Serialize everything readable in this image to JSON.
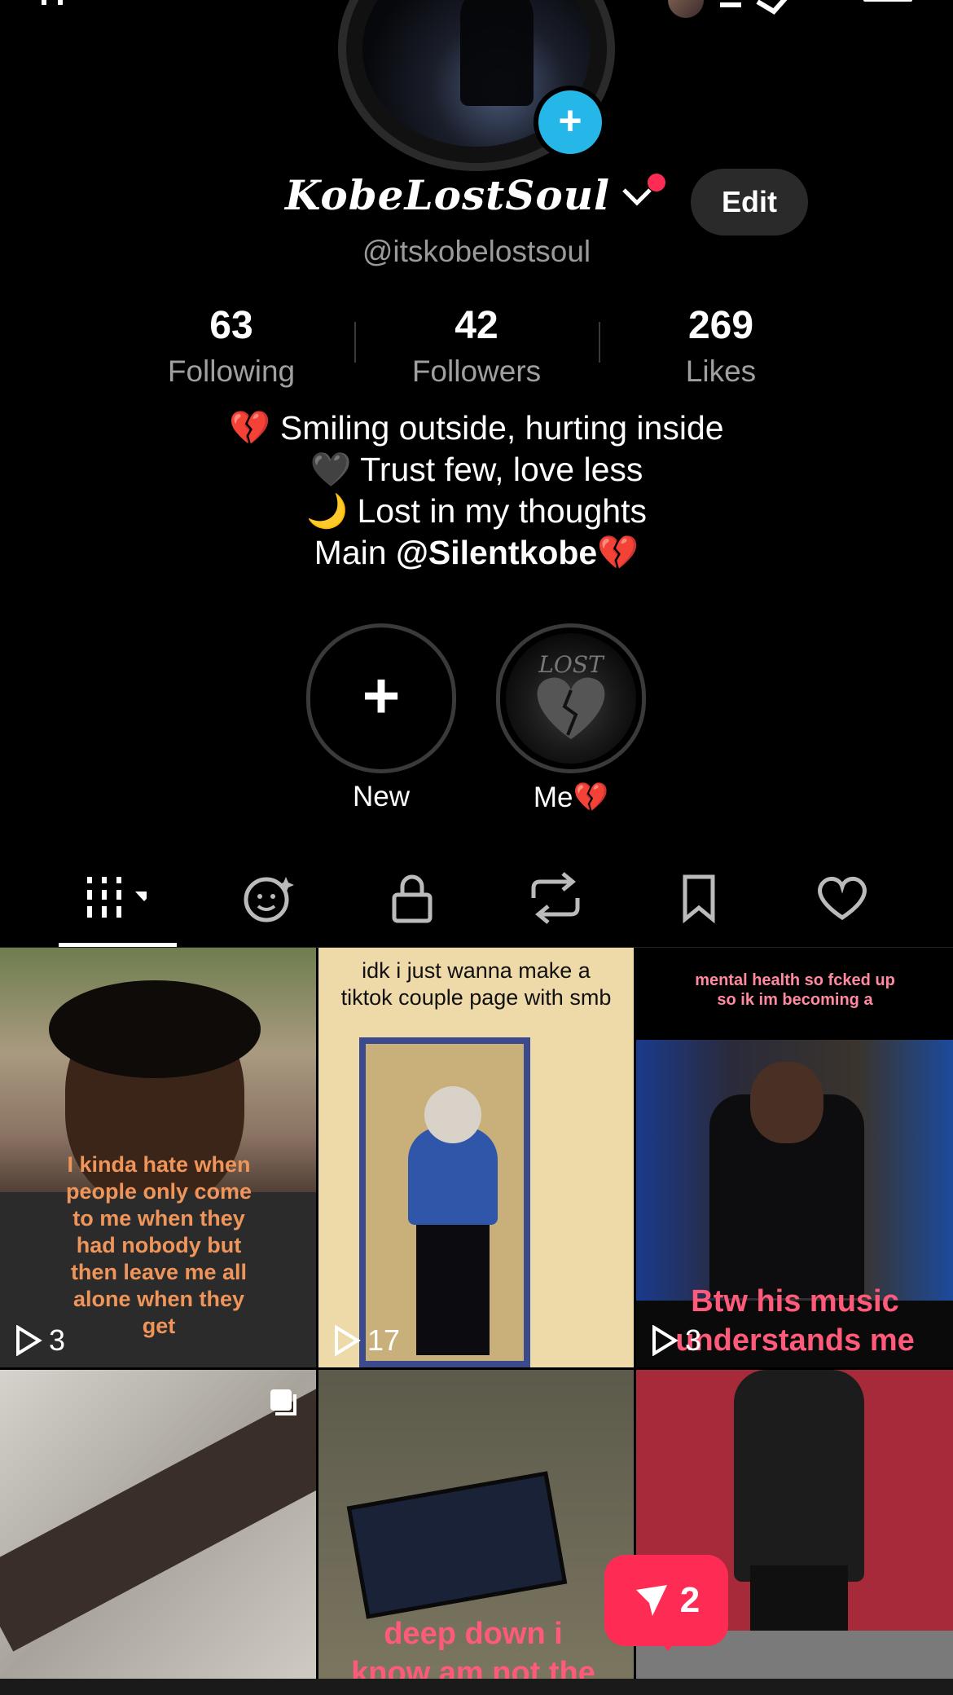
{
  "profile": {
    "display_name": "KobeLostSoul",
    "handle": "@itskobelostsoul",
    "edit_label": "Edit",
    "stats": [
      {
        "value": "63",
        "label": "Following"
      },
      {
        "value": "42",
        "label": "Followers"
      },
      {
        "value": "269",
        "label": "Likes"
      }
    ],
    "bio": {
      "line1": "💔 Smiling outside, hurting inside",
      "line2": "🖤 Trust few, love less",
      "line3": "🌙 Lost in my thoughts",
      "line4_prefix": "Main ",
      "line4_mention": "@Silentkobe",
      "line4_suffix": "💔"
    }
  },
  "highlights": [
    {
      "label": "New"
    },
    {
      "label": "Me💔"
    }
  ],
  "tabs": [
    "videos-grid-icon",
    "reposts-face-icon",
    "lock-icon",
    "repost-icon",
    "bookmark-icon",
    "heart-icon"
  ],
  "grid": [
    {
      "caption": "I kinda hate when people only come to me when they had nobody but then leave me all alone when they get",
      "views": "3"
    },
    {
      "caption": "idk i just wanna make a tiktok couple page with smb",
      "views": "17"
    },
    {
      "caption_top": "mental health so fcked up so ik im becoming a",
      "caption": "Btw his music understands me",
      "views": "3"
    },
    {
      "caption": ""
    },
    {
      "caption": "deep down i know am not the"
    },
    {
      "caption": ""
    }
  ],
  "share": {
    "count": "2"
  },
  "colors": {
    "accent": "#fe2c55",
    "add_blue": "#25b7e8",
    "background": "#000000"
  }
}
